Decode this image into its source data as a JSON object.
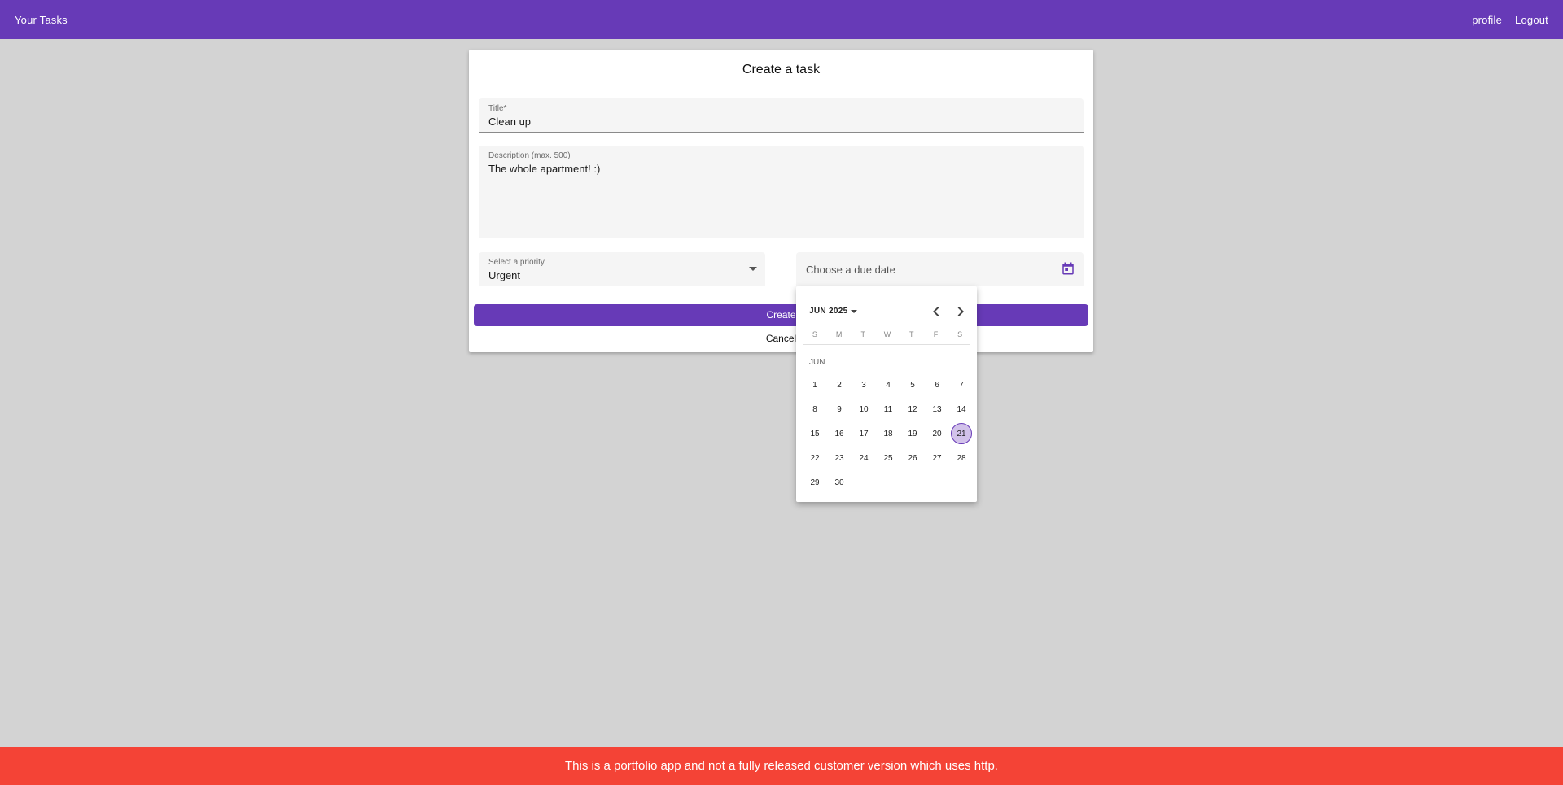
{
  "toolbar": {
    "app_title": "Your Tasks",
    "profile_link": "profile",
    "logout_link": "Logout"
  },
  "form": {
    "heading": "Create a task",
    "title_field": {
      "label": "Title*",
      "value": "Clean up"
    },
    "description_field": {
      "label": "Description (max. 500)",
      "value": "The whole apartment! :)"
    },
    "priority_field": {
      "label": "Select a priority",
      "value": "Urgent"
    },
    "due_date_field": {
      "placeholder": "Choose a due date",
      "icon": "calendar-icon"
    },
    "create_button": "Create",
    "cancel_button": "Cancel"
  },
  "datepicker": {
    "period_label": "JUN 2025",
    "month_label": "JUN",
    "weekdays": [
      "S",
      "M",
      "T",
      "W",
      "T",
      "F",
      "S"
    ],
    "weeks": [
      [
        "1",
        "2",
        "3",
        "4",
        "5",
        "6",
        "7"
      ],
      [
        "8",
        "9",
        "10",
        "11",
        "12",
        "13",
        "14"
      ],
      [
        "15",
        "16",
        "17",
        "18",
        "19",
        "20",
        "21"
      ],
      [
        "22",
        "23",
        "24",
        "25",
        "26",
        "27",
        "28"
      ],
      [
        "29",
        "30",
        "",
        "",
        "",
        "",
        ""
      ]
    ],
    "today": "21"
  },
  "banner": {
    "text": "This is a portfolio app and not a fully released customer version which uses http."
  },
  "colors": {
    "primary": "#673ab7",
    "banner": "#f44336",
    "background": "#d3d3d3",
    "today_highlight": "#d2c2ea"
  }
}
